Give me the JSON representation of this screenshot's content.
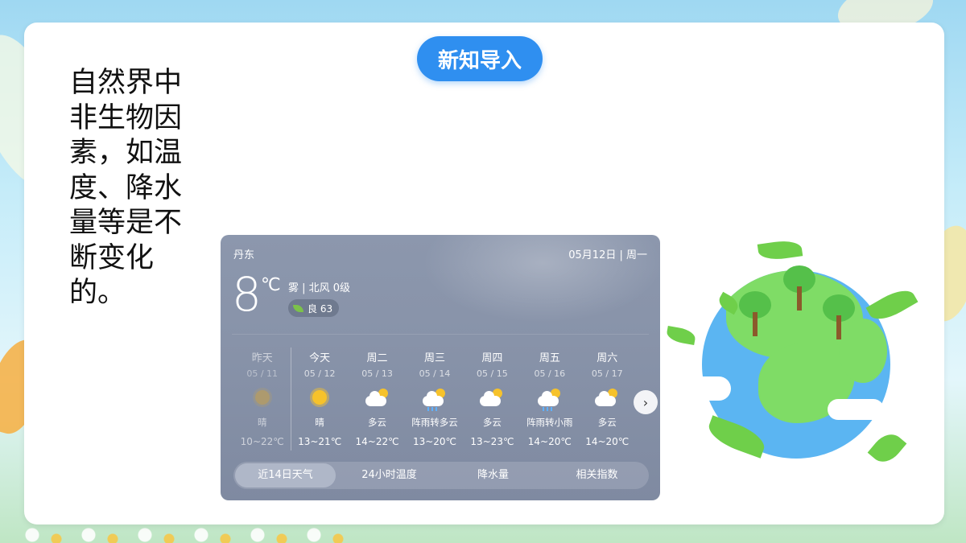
{
  "section_title": "新知导入",
  "intro_text": "自然界中非生物因素，如温度、降水量等是不断变化的。",
  "weather": {
    "city": "丹东",
    "date": "05月12日 | 周一",
    "temperature": "8",
    "unit": "℃",
    "condition": "雾 | 北风 0级",
    "aqi": "良 63",
    "days": [
      {
        "name": "昨天",
        "date": "05 / 11",
        "icon": "sun-icon",
        "desc": "晴",
        "range": "10~22℃"
      },
      {
        "name": "今天",
        "date": "05 / 12",
        "icon": "sun-icon",
        "desc": "晴",
        "range": "13~21℃"
      },
      {
        "name": "周二",
        "date": "05 / 13",
        "icon": "partly-cloudy-icon",
        "desc": "多云",
        "range": "14~22℃"
      },
      {
        "name": "周三",
        "date": "05 / 14",
        "icon": "shower-icon",
        "desc": "阵雨转多云",
        "range": "13~20℃"
      },
      {
        "name": "周四",
        "date": "05 / 15",
        "icon": "partly-cloudy-icon",
        "desc": "多云",
        "range": "13~23℃"
      },
      {
        "name": "周五",
        "date": "05 / 16",
        "icon": "shower-icon",
        "desc": "阵雨转小雨",
        "range": "14~20℃"
      },
      {
        "name": "周六",
        "date": "05 / 17",
        "icon": "partly-cloudy-icon",
        "desc": "多云",
        "range": "14~20℃"
      }
    ],
    "tabs": [
      "近14日天气",
      "24小时温度",
      "降水量",
      "相关指数"
    ],
    "active_tab": "近14日天气"
  },
  "colors": {
    "accent": "#2f8ff0",
    "widget_bg": "#8893a9",
    "globe_ocean": "#5bb5f2",
    "globe_land": "#7fdc66"
  }
}
